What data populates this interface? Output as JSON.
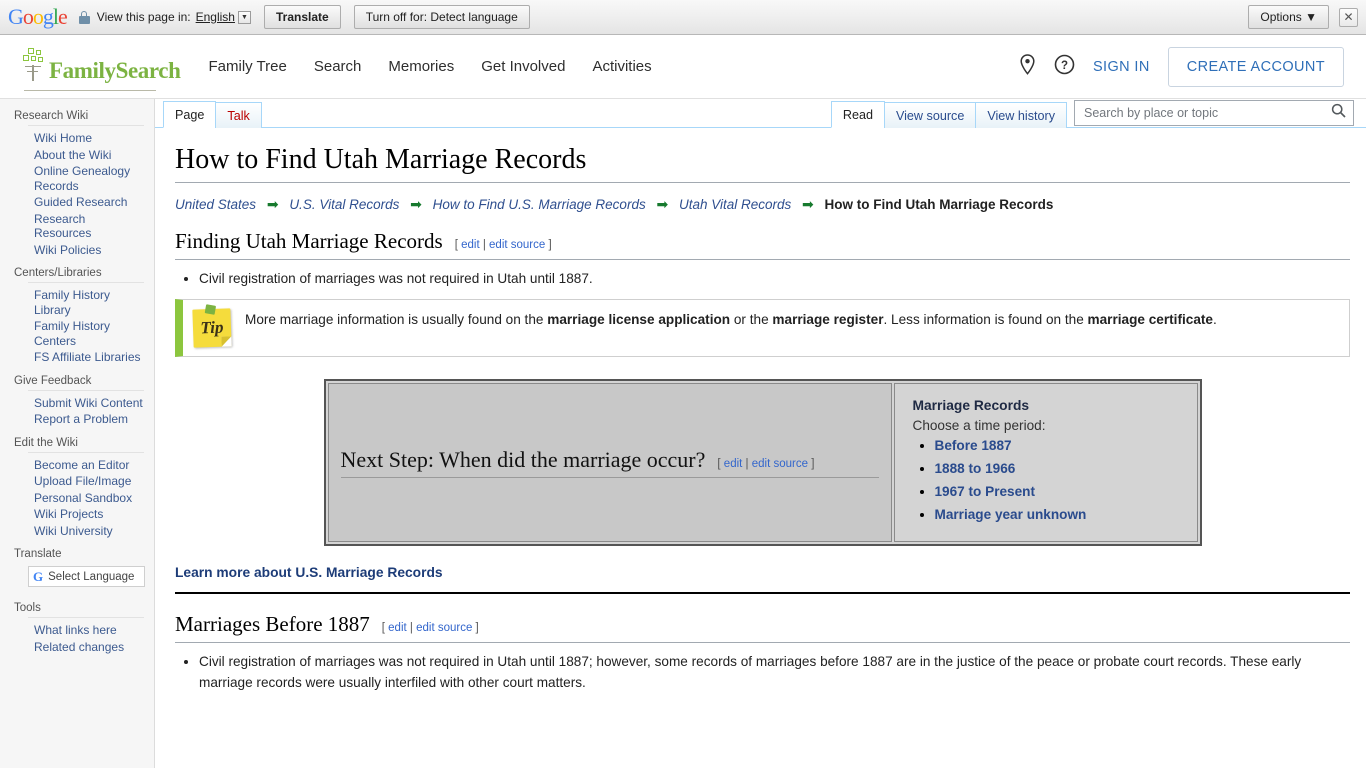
{
  "translate_bar": {
    "logo": "Google",
    "lock_icon": "lock-icon",
    "view_text": "View this page in:",
    "language": "English",
    "dropdown_caret": "▼",
    "translate_button": "Translate",
    "turn_off_button": "Turn off for: Detect language",
    "options_button": "Options ▼",
    "close_icon": "✕"
  },
  "site_header": {
    "brand": "FamilySearch",
    "nav": [
      {
        "label": "Family Tree"
      },
      {
        "label": "Search"
      },
      {
        "label": "Memories"
      },
      {
        "label": "Get Involved"
      },
      {
        "label": "Activities"
      }
    ],
    "pin_icon": "map-pin-icon",
    "help_icon": "help-circle-icon",
    "sign_in": "SIGN IN",
    "create_account": "CREATE ACCOUNT"
  },
  "sidebar": {
    "groups": [
      {
        "title": "Research Wiki",
        "items": [
          {
            "label": "Wiki Home"
          },
          {
            "label": "About the Wiki"
          },
          {
            "label": "Online Genealogy Records"
          },
          {
            "label": "Guided Research"
          },
          {
            "label": "Research Resources"
          },
          {
            "label": "Wiki Policies"
          }
        ]
      },
      {
        "title": "Centers/Libraries",
        "items": [
          {
            "label": "Family History Library"
          },
          {
            "label": "Family History Centers"
          },
          {
            "label": "FS Affiliate Libraries"
          }
        ]
      },
      {
        "title": "Give Feedback",
        "items": [
          {
            "label": "Submit Wiki Content"
          },
          {
            "label": "Report a Problem"
          }
        ]
      },
      {
        "title": "Edit the Wiki",
        "items": [
          {
            "label": "Become an Editor"
          },
          {
            "label": "Upload File/Image"
          },
          {
            "label": "Personal Sandbox"
          },
          {
            "label": "Wiki Projects"
          },
          {
            "label": "Wiki University"
          }
        ]
      }
    ],
    "translate_title": "Translate",
    "select_language": "Select Language",
    "tools_title": "Tools",
    "tools_items": [
      {
        "label": "What links here"
      },
      {
        "label": "Related changes"
      }
    ]
  },
  "tabs": {
    "namespace": [
      {
        "label": "Page",
        "selected": true
      },
      {
        "label": "Talk",
        "selected": false
      }
    ],
    "actions": [
      {
        "label": "Read",
        "selected": true
      },
      {
        "label": "View source",
        "selected": false
      },
      {
        "label": "View history",
        "selected": false
      }
    ]
  },
  "search": {
    "placeholder": "Search by place or topic",
    "value": "",
    "icon": "search-icon"
  },
  "article": {
    "title": "How to Find Utah Marriage Records",
    "breadcrumb": [
      {
        "label": "United States",
        "current": false
      },
      {
        "label": "U.S. Vital Records",
        "current": false
      },
      {
        "label": "How to Find U.S. Marriage Records",
        "current": false
      },
      {
        "label": "Utah Vital Records",
        "current": false
      },
      {
        "label": "How to Find Utah Marriage Records",
        "current": true
      }
    ],
    "breadcrumb_arrow": "➡",
    "section1": {
      "heading": "Finding Utah Marriage Records",
      "edit": "edit",
      "edit_source": "edit source",
      "bullets": [
        "Civil registration of marriages was not required in Utah until 1887."
      ]
    },
    "tip": {
      "icon_label": "Tip",
      "text_part1": "More marriage information is usually found on the ",
      "bold1": "marriage license application",
      "text_part2": " or the ",
      "bold2": "marriage register",
      "text_part3": ". Less information is found on the ",
      "bold3": "marriage certificate",
      "text_part4": "."
    },
    "next_step": {
      "heading": "Next Step: When did the marriage occur?",
      "edit": "edit",
      "edit_source": "edit source",
      "panel_title": "Marriage Records",
      "panel_subtitle": "Choose a time period:",
      "options": [
        {
          "label": "Before 1887"
        },
        {
          "label": "1888 to 1966"
        },
        {
          "label": "1967 to Present"
        },
        {
          "label": "Marriage year unknown"
        }
      ]
    },
    "learn_more": "Learn more about U.S. Marriage Records",
    "section2": {
      "heading": "Marriages Before 1887",
      "edit": "edit",
      "edit_source": "edit source",
      "bullets": [
        "Civil registration of marriages was not required in Utah until 1887; however, some records of marriages before 1887 are in the justice of the peace or probate court records. These early marriage records were usually interfiled with other court matters."
      ]
    }
  },
  "colors": {
    "brand_green": "#7cb342",
    "link_blue": "#2a4b8d",
    "tab_border": "#a7d7f9",
    "tip_bar": "#8cc63e"
  }
}
